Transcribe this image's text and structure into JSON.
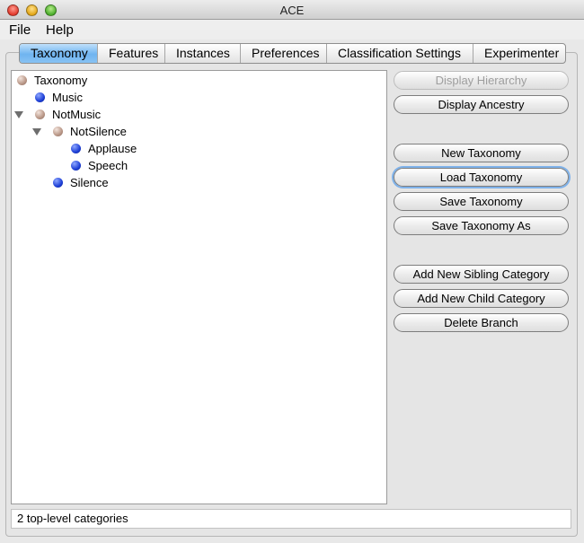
{
  "window": {
    "title": "ACE"
  },
  "menu": {
    "items": [
      "File",
      "Help"
    ]
  },
  "tabs": [
    {
      "label": "Taxonomy"
    },
    {
      "label": "Features"
    },
    {
      "label": "Instances"
    },
    {
      "label": "Preferences"
    },
    {
      "label": "Classification Settings"
    },
    {
      "label": "Experimenter"
    }
  ],
  "tree": {
    "nodes": [
      {
        "label": "Taxonomy",
        "icon": "brown-ball"
      },
      {
        "label": "Music",
        "icon": "blue-ball"
      },
      {
        "label": "NotMusic",
        "icon": "brown-ball",
        "expanded": true
      },
      {
        "label": "NotSilence",
        "icon": "brown-ball",
        "expanded": true
      },
      {
        "label": "Applause",
        "icon": "blue-ball"
      },
      {
        "label": "Speech",
        "icon": "blue-ball"
      },
      {
        "label": "Silence",
        "icon": "blue-ball"
      }
    ]
  },
  "buttons": {
    "display_hierarchy": "Display Hierarchy",
    "display_ancestry": "Display Ancestry",
    "new_taxonomy": "New Taxonomy",
    "load_taxonomy": "Load Taxonomy",
    "save_taxonomy": "Save Taxonomy",
    "save_taxonomy_as": "Save Taxonomy As",
    "add_sibling": "Add New Sibling Category",
    "add_child": "Add New Child Category",
    "delete_branch": "Delete Branch"
  },
  "status": "2 top-level categories"
}
